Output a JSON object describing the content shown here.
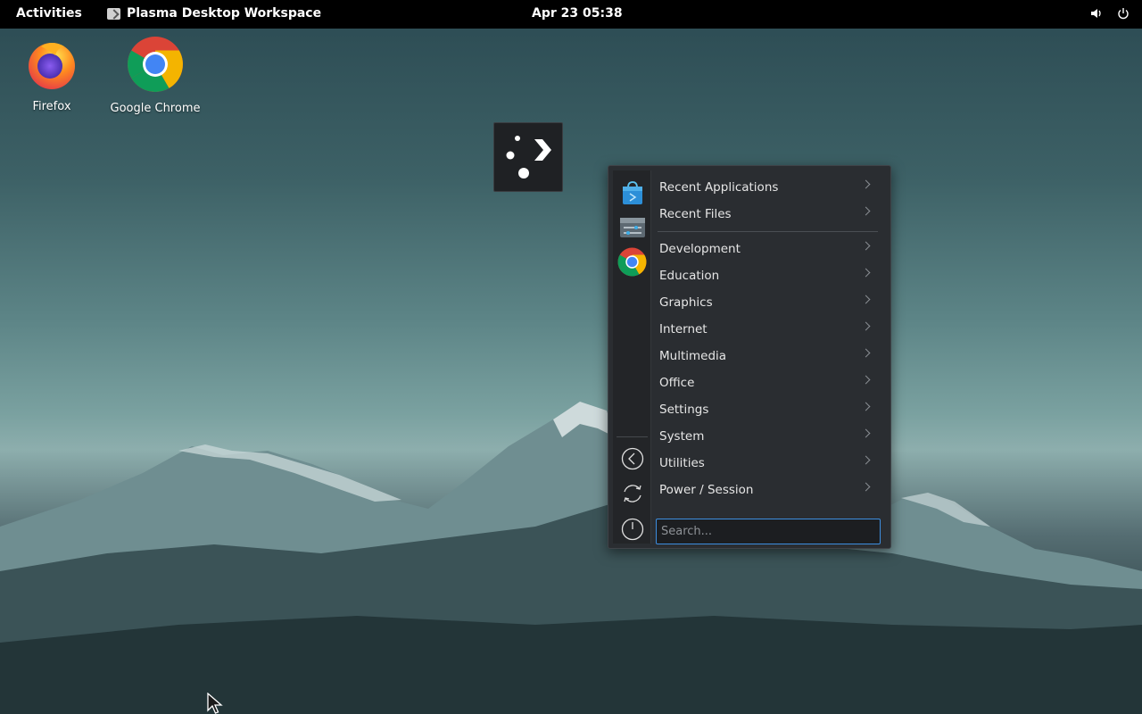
{
  "topbar": {
    "activities": "Activities",
    "app_name": "Plasma Desktop Workspace",
    "clock": "Apr 23  05:38",
    "tray_icons": [
      "volume-icon",
      "power-icon"
    ]
  },
  "desktop": {
    "icons": [
      {
        "label": "Firefox",
        "icon": "firefox-icon"
      },
      {
        "label": "Google Chrome",
        "icon": "chrome-icon"
      }
    ]
  },
  "menu": {
    "sidebar": {
      "favorites": [
        "software-store-icon",
        "system-settings-icon",
        "chrome-icon"
      ],
      "actions": [
        "back-icon",
        "refresh-icon",
        "power-icon"
      ]
    },
    "recent": [
      "Recent Applications",
      "Recent Files"
    ],
    "categories": [
      "Development",
      "Education",
      "Graphics",
      "Internet",
      "Multimedia",
      "Office",
      "Settings",
      "System",
      "Utilities",
      "Power / Session"
    ],
    "search_placeholder": "Search..."
  },
  "colors": {
    "accent": "#3d8ee0",
    "menu_bg": "#2a2d31",
    "topbar_bg": "#000000"
  }
}
